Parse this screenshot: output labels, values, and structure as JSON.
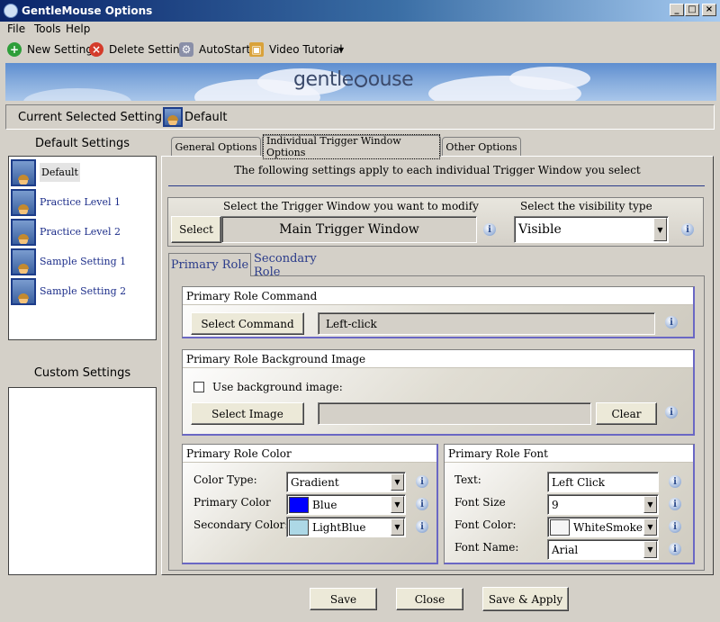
{
  "window": {
    "title": "GentleMouse Options"
  },
  "menu": [
    "File",
    "Tools",
    "Help"
  ],
  "toolbar": {
    "new_setting": "New Setting",
    "delete_setting": "Delete Setting",
    "autostart": "AutoStart",
    "video_tutorial": "Video Tutorial"
  },
  "banner": {
    "logo_text": "gentle",
    "logo_text2": "ouse"
  },
  "current": {
    "label": "Current Selected Setting:",
    "value": "Default"
  },
  "default_settings": {
    "title": "Default Settings",
    "items": [
      "Default",
      "Practice Level 1",
      "Practice Level 2",
      "Sample Setting 1",
      "Sample Setting 2"
    ]
  },
  "custom_settings": {
    "title": "Custom Settings"
  },
  "tabs": [
    "General Options",
    "Individual Trigger Window Options",
    "Other Options"
  ],
  "trigger": {
    "info_text": "The following settings apply to each individual Trigger Window you select",
    "select_window_label": "Select the Trigger Window you want to modify",
    "select_button": "Select",
    "window_value": "Main Trigger Window",
    "visibility_label": "Select the visibility type",
    "visibility_value": "Visible"
  },
  "role_tabs": [
    "Primary Role",
    "Secondary Role"
  ],
  "command": {
    "title": "Primary Role Command",
    "button": "Select Command",
    "value": "Left-click"
  },
  "bgimage": {
    "title": "Primary Role Background Image",
    "checkbox_label": "Use background image:",
    "button": "Select Image",
    "value": "",
    "clear": "Clear"
  },
  "color": {
    "title": "Primary Role Color",
    "type_label": "Color Type:",
    "type_value": "Gradient",
    "primary_label": "Primary Color",
    "primary_value": "Blue",
    "primary_hex": "#0000ff",
    "secondary_label": "Secondary Color:",
    "secondary_value": "LightBlue",
    "secondary_hex": "#add8e6"
  },
  "font": {
    "title": "Primary Role Font",
    "text_label": "Text:",
    "text_value": "Left Click",
    "size_label": "Font Size",
    "size_value": "9",
    "color_label": "Font Color:",
    "color_value": "WhiteSmoke",
    "color_hex": "#f5f5f5",
    "name_label": "Font Name:",
    "name_value": "Arial"
  },
  "footer": {
    "save": "Save",
    "close": "Close",
    "save_apply": "Save & Apply"
  }
}
